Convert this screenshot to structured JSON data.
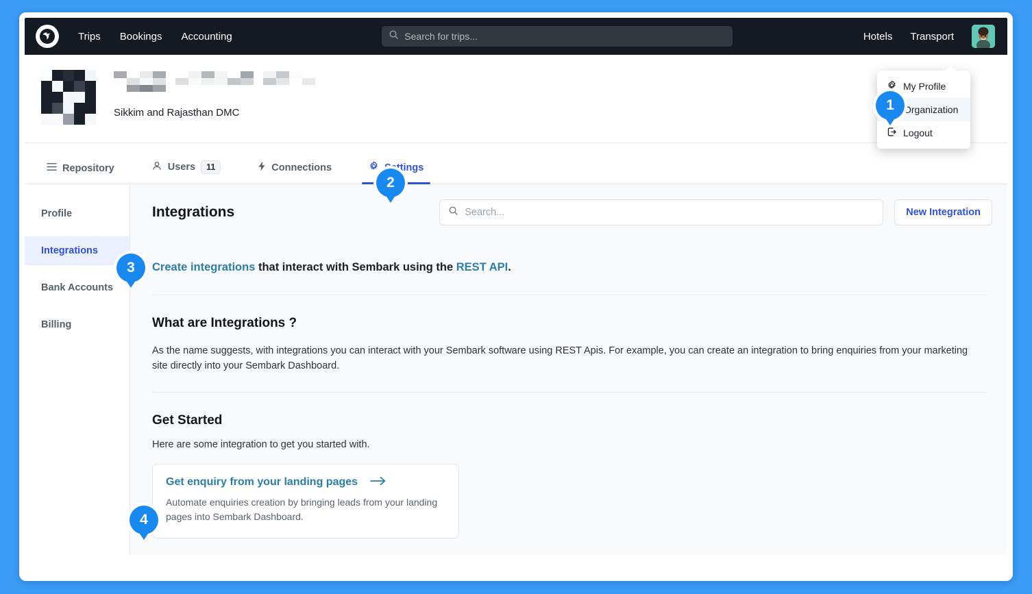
{
  "header": {
    "brand_icon": "sembark-logo-icon",
    "nav": [
      {
        "label": "Trips"
      },
      {
        "label": "Bookings"
      },
      {
        "label": "Accounting"
      }
    ],
    "search": {
      "placeholder": "Search for trips...",
      "value": "",
      "icon": "search-icon"
    },
    "right_nav": [
      {
        "label": "Hotels"
      },
      {
        "label": "Transport"
      }
    ],
    "avatar": {
      "alt": "user-avatar"
    }
  },
  "user_menu": {
    "items": [
      {
        "label": "My Profile",
        "icon": "gear-icon",
        "active": false
      },
      {
        "label": "Organization",
        "icon": "users-icon",
        "active": true
      },
      {
        "label": "Logout",
        "icon": "logout-icon",
        "active": false
      }
    ]
  },
  "organization": {
    "logo": "organization-logo-pixelated",
    "name_redacted": true,
    "subtitle": "Sikkim and Rajasthan DMC"
  },
  "tabs": [
    {
      "label": "Repository",
      "icon": "list-icon",
      "active": false,
      "count": null
    },
    {
      "label": "Users",
      "icon": "users-icon",
      "active": false,
      "count": "11"
    },
    {
      "label": "Connections",
      "icon": "bolt-icon",
      "active": false,
      "count": null
    },
    {
      "label": "Settings",
      "icon": "gear-icon",
      "active": true,
      "count": null
    }
  ],
  "sidebar": {
    "items": [
      {
        "label": "Profile",
        "active": false
      },
      {
        "label": "Integrations",
        "active": true
      },
      {
        "label": "Bank Accounts",
        "active": false
      },
      {
        "label": "Billing",
        "active": false
      }
    ]
  },
  "main": {
    "title": "Integrations",
    "search": {
      "placeholder": "Search...",
      "value": "",
      "icon": "search-icon"
    },
    "new_button": "New Integration",
    "lead": {
      "link1": "Create integrations",
      "mid": " that interact with Sembark using the ",
      "link2": "REST API",
      "end": "."
    },
    "what": {
      "heading": "What are Integrations ?",
      "body": "As the name suggests, with integrations you can interact with your Sembark software using REST Apis. For example, you can create an integration to bring enquiries from your marketing site directly into your Sembark Dashboard."
    },
    "get_started": {
      "heading": "Get Started",
      "subtitle": "Here are some integration to get you started with.",
      "cards": [
        {
          "title": "Get enquiry from your landing pages",
          "arrow_icon": "arrow-right-icon",
          "description": "Automate enquiries creation by bringing leads from your landing pages into Sembark Dashboard."
        }
      ]
    }
  },
  "steps": [
    {
      "number": "1"
    },
    {
      "number": "2"
    },
    {
      "number": "3"
    },
    {
      "number": "4"
    }
  ],
  "colors": {
    "page_background": "#3b9bf5",
    "topnav": "#131a21",
    "accent_blue": "#2f51d8",
    "link_teal": "#2b7ea8",
    "step_marker": "#1989f0"
  }
}
